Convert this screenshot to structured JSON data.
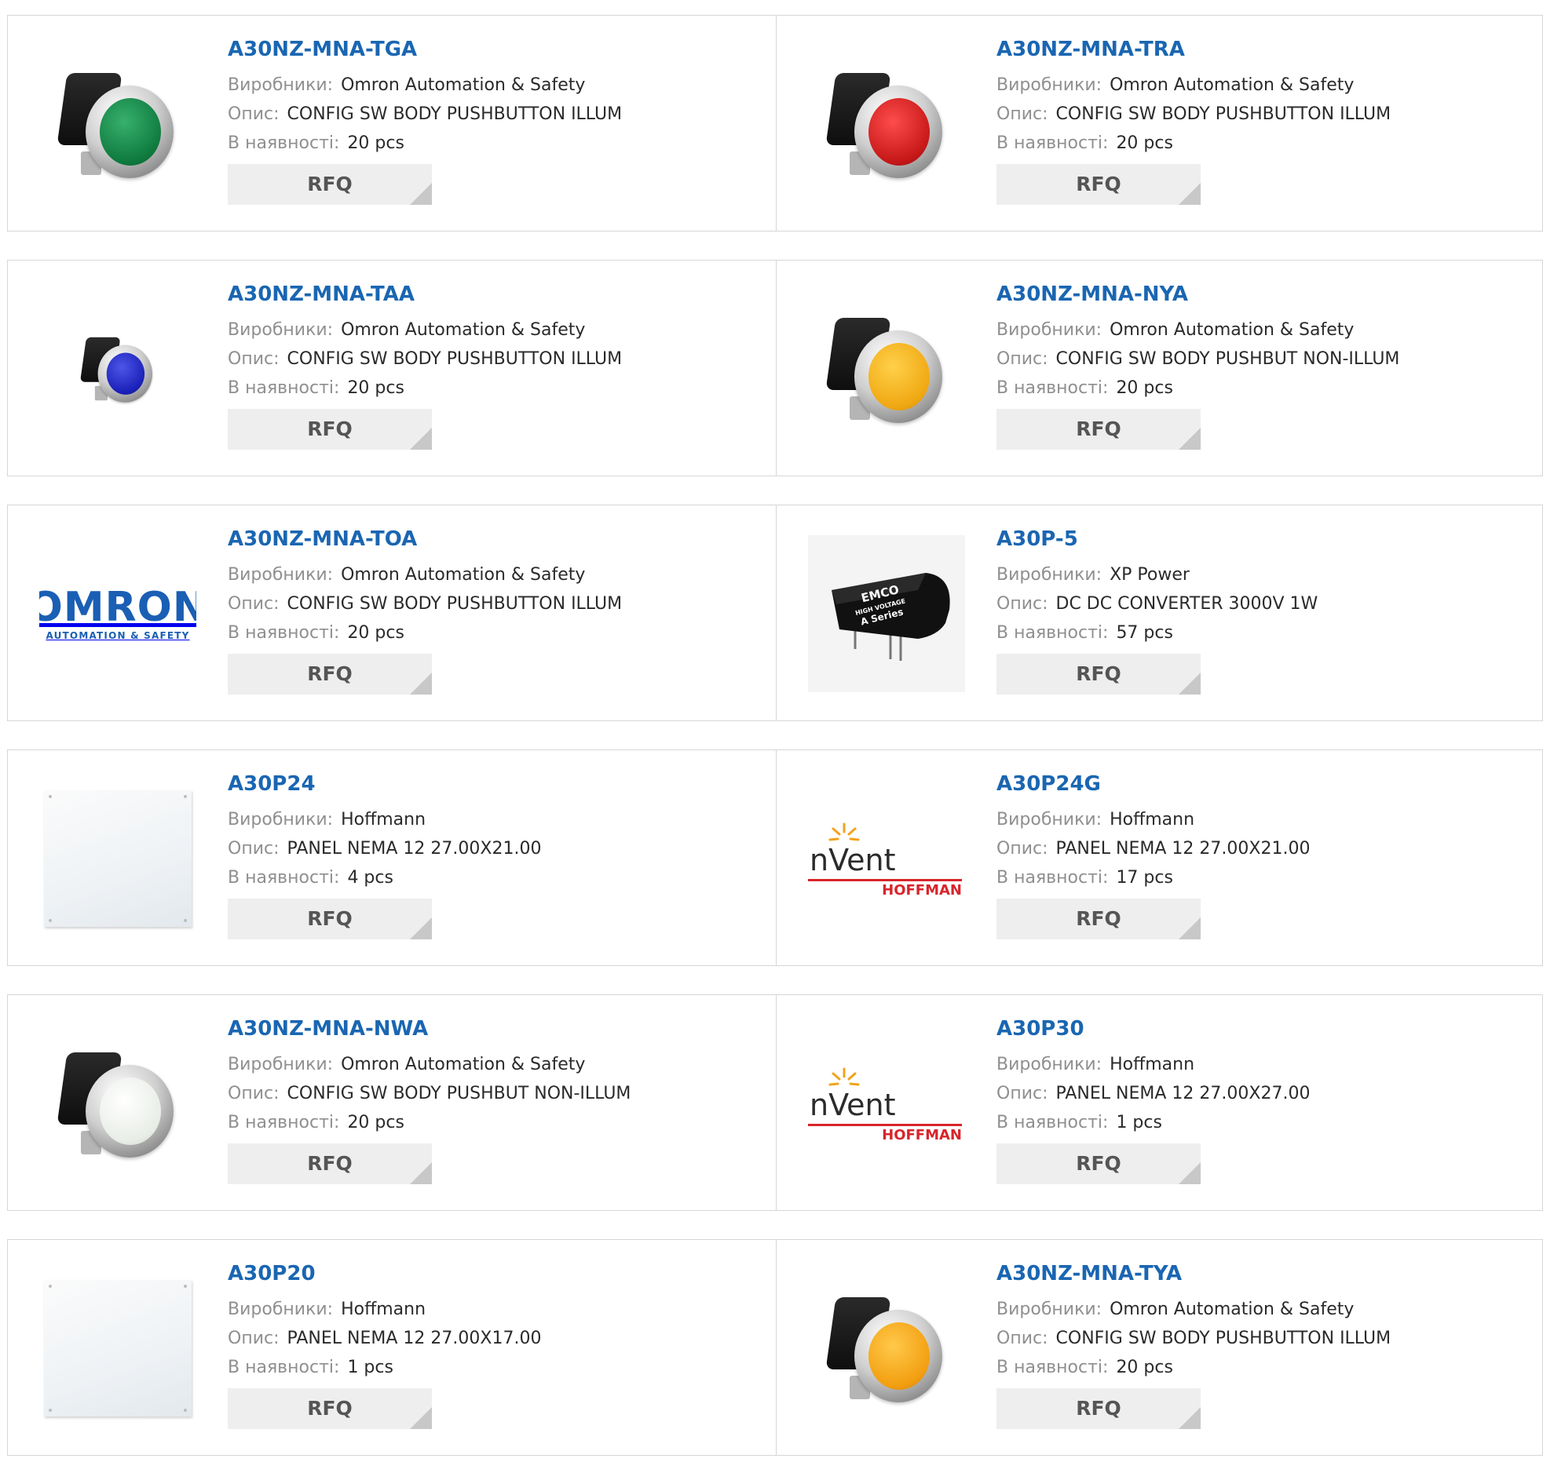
{
  "labels": {
    "manufacturer": "Виробники:",
    "description": "Опис:",
    "stock": "В наявності:",
    "rfq": "RFQ"
  },
  "products": [
    {
      "name": "A30NZ-MNA-TGA",
      "manufacturer": "Omron Automation & Safety",
      "description": "CONFIG SW BODY PUSHBUTTON ILLUM",
      "stock": "20 pcs",
      "image": "green-pushbutton-image"
    },
    {
      "name": "A30NZ-MNA-TRA",
      "manufacturer": "Omron Automation & Safety",
      "description": "CONFIG SW BODY PUSHBUTTON ILLUM",
      "stock": "20 pcs",
      "image": "red-pushbutton-image"
    },
    {
      "name": "A30NZ-MNA-TAA",
      "manufacturer": "Omron Automation & Safety",
      "description": "CONFIG SW BODY PUSHBUTTON ILLUM",
      "stock": "20 pcs",
      "image": "blue-pushbutton-image"
    },
    {
      "name": "A30NZ-MNA-NYA",
      "manufacturer": "Omron Automation & Safety",
      "description": "CONFIG SW BODY PUSHBUT NON-ILLUM",
      "stock": "20 pcs",
      "image": "yellow-pushbutton-image"
    },
    {
      "name": "A30NZ-MNA-TOA",
      "manufacturer": "Omron Automation & Safety",
      "description": "CONFIG SW BODY PUSHBUTTON ILLUM",
      "stock": "20 pcs",
      "image": "omron-logo",
      "logo_text": "OMRON",
      "logo_subtext": "AUTOMATION & SAFETY"
    },
    {
      "name": "A30P-5",
      "manufacturer": "XP Power",
      "description": "DC DC CONVERTER 3000V 1W",
      "stock": "57 pcs",
      "image": "emco-converter-image",
      "logo_text": "EMCO",
      "logo_subtext": "HIGH VOLTAGE",
      "logo_series": "A Series"
    },
    {
      "name": "A30P24",
      "manufacturer": "Hoffmann",
      "description": "PANEL NEMA 12 27.00X21.00",
      "stock": "4 pcs",
      "image": "white-panel-image"
    },
    {
      "name": "A30P24G",
      "manufacturer": "Hoffmann",
      "description": "PANEL NEMA 12 27.00X21.00",
      "stock": "17 pcs",
      "image": "nvent-hoffman-logo",
      "logo_text": "nVent",
      "logo_subtext": "HOFFMAN"
    },
    {
      "name": "A30NZ-MNA-NWA",
      "manufacturer": "Omron Automation & Safety",
      "description": "CONFIG SW BODY PUSHBUT NON-ILLUM",
      "stock": "20 pcs",
      "image": "white-pushbutton-image"
    },
    {
      "name": "A30P30",
      "manufacturer": "Hoffmann",
      "description": "PANEL NEMA 12 27.00X27.00",
      "stock": "1 pcs",
      "image": "nvent-hoffman-logo",
      "logo_text": "nVent",
      "logo_subtext": "HOFFMAN"
    },
    {
      "name": "A30P20",
      "manufacturer": "Hoffmann",
      "description": "PANEL NEMA 12 27.00X17.00",
      "stock": "1 pcs",
      "image": "white-panel-image"
    },
    {
      "name": "A30NZ-MNA-TYA",
      "manufacturer": "Omron Automation & Safety",
      "description": "CONFIG SW BODY PUSHBUTTON ILLUM",
      "stock": "20 pcs",
      "image": "amber-pushbutton-image"
    }
  ],
  "colors": {
    "link": "#1a66b2",
    "label": "#8f8f8f",
    "value": "#2a2a2a",
    "border": "#d6d6d6",
    "rfq_bg": "#eeeeee",
    "omron_blue": "#1a5fb4",
    "hoffman_red": "#d9242b"
  }
}
